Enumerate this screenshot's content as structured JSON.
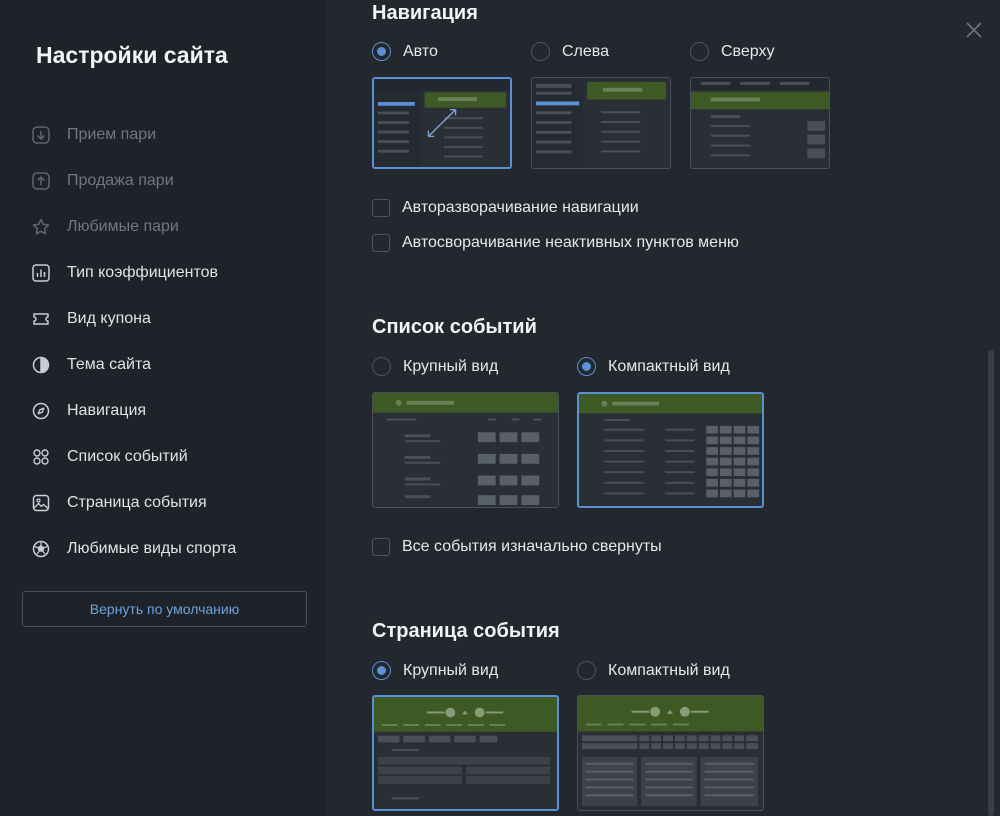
{
  "sidebar": {
    "title": "Настройки сайта",
    "items": [
      {
        "label": "Прием пари",
        "icon": "arrow-down-circle-icon"
      },
      {
        "label": "Продажа пари",
        "icon": "arrow-up-circle-icon"
      },
      {
        "label": "Любимые пари",
        "icon": "star-icon"
      },
      {
        "label": "Тип коэффициентов",
        "icon": "bar-chart-icon"
      },
      {
        "label": "Вид купона",
        "icon": "ticket-icon"
      },
      {
        "label": "Тема сайта",
        "icon": "half-circle-icon"
      },
      {
        "label": "Навигация",
        "icon": "compass-icon"
      },
      {
        "label": "Список событий",
        "icon": "grid-icon"
      },
      {
        "label": "Страница события",
        "icon": "image-icon"
      },
      {
        "label": "Любимые виды спорта",
        "icon": "soccer-ball-icon"
      }
    ],
    "reset_label": "Вернуть по умолчанию"
  },
  "navigation": {
    "title": "Навигация",
    "options": [
      {
        "label": "Авто",
        "checked": true
      },
      {
        "label": "Слева",
        "checked": false
      },
      {
        "label": "Сверху",
        "checked": false
      }
    ],
    "checkboxes": [
      {
        "label": "Авторазворачивание навигации",
        "checked": false
      },
      {
        "label": "Автосворачивание неактивных пунктов меню",
        "checked": false
      }
    ]
  },
  "events_list": {
    "title": "Список событий",
    "options": [
      {
        "label": "Крупный вид",
        "checked": false
      },
      {
        "label": "Компактный вид",
        "checked": true
      }
    ],
    "checkbox": {
      "label": "Все события изначально свернуты",
      "checked": false
    }
  },
  "event_page": {
    "title": "Страница события",
    "options": [
      {
        "label": "Крупный вид",
        "checked": true
      },
      {
        "label": "Компактный вид",
        "checked": false
      }
    ]
  },
  "colors": {
    "accent": "#5b8fd6",
    "preview_header": "#3d5a25",
    "link": "#6aa3e0"
  }
}
